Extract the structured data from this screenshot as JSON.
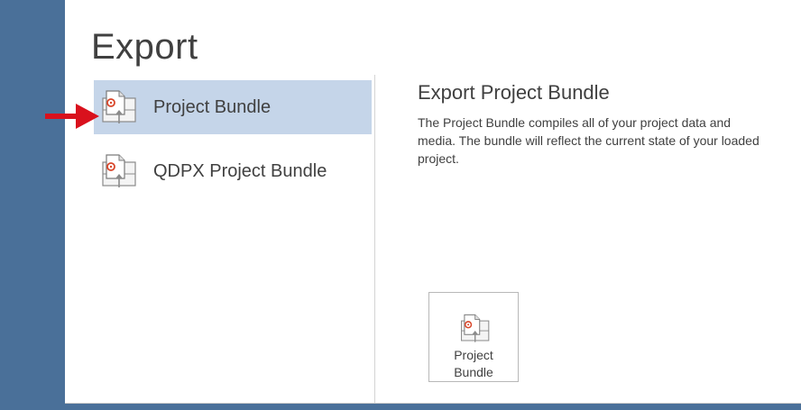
{
  "page": {
    "title": "Export"
  },
  "nav": {
    "items": [
      {
        "label": "Project Bundle",
        "selected": true
      },
      {
        "label": "QDPX Project Bundle",
        "selected": false
      }
    ]
  },
  "details": {
    "title": "Export Project Bundle",
    "description": "The Project Bundle compiles all of your project data and media. The bundle will reflect the current state of your loaded project.",
    "button_label": "Project Bundle"
  },
  "colors": {
    "window_bg": "#4a7099",
    "selected_bg": "#c5d5e9",
    "annotation_arrow": "#d9111d",
    "icon_accent": "#d9472b"
  }
}
